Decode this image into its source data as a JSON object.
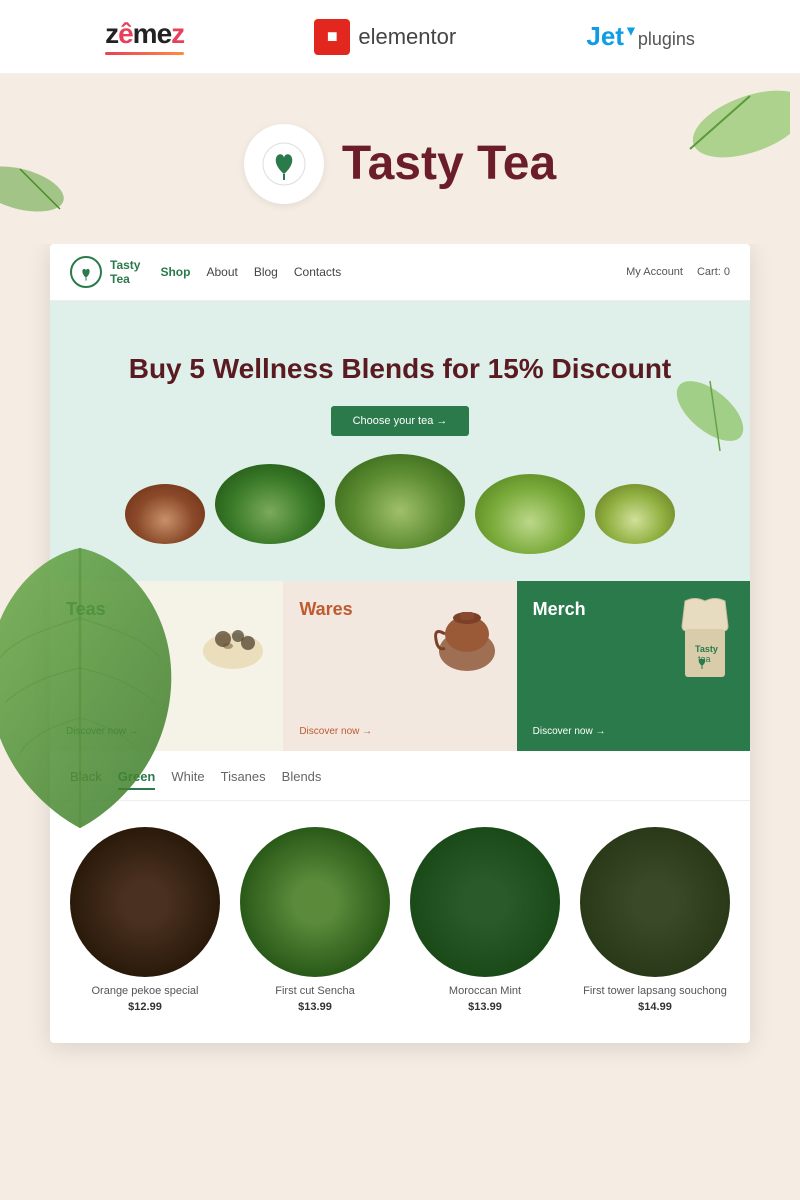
{
  "brandBar": {
    "zemes": {
      "text1": "zem",
      "text2": "e",
      "text3": "z",
      "underline": "~~"
    },
    "elementor": {
      "icon": "E",
      "label": "elementor"
    },
    "jet": {
      "jet": "Jet",
      "plugins": "plugins"
    }
  },
  "heroBrand": {
    "brandName": "Tasty Tea"
  },
  "siteNav": {
    "logoText": "Tasty\nTea",
    "links": [
      "Shop",
      "About",
      "Blog",
      "Contacts"
    ],
    "right": [
      "My Account",
      "Cart: 0"
    ]
  },
  "heroBanner": {
    "title": "Buy 5 Wellness Blends for 15% Discount",
    "buttonLabel": "Choose your tea →"
  },
  "categories": [
    {
      "id": "teas",
      "title": "Teas",
      "discover": "Discover now →"
    },
    {
      "id": "wares",
      "title": "Wares",
      "discover": "Discover now →"
    },
    {
      "id": "merch",
      "title": "Merch",
      "discover": "Discover now →"
    }
  ],
  "productTabs": {
    "tabs": [
      "Black",
      "Green",
      "White",
      "Tisanes",
      "Blends"
    ],
    "active": "Green"
  },
  "products": [
    {
      "name": "Orange pekoe special",
      "price": "$12.99",
      "imgClass": "product-img-1"
    },
    {
      "name": "First cut Sencha",
      "price": "$13.99",
      "imgClass": "product-img-2"
    },
    {
      "name": "Moroccan Mint",
      "price": "$13.99",
      "imgClass": "product-img-3"
    },
    {
      "name": "First tower lapsang souchong",
      "price": "$14.99",
      "imgClass": "product-img-4"
    }
  ]
}
